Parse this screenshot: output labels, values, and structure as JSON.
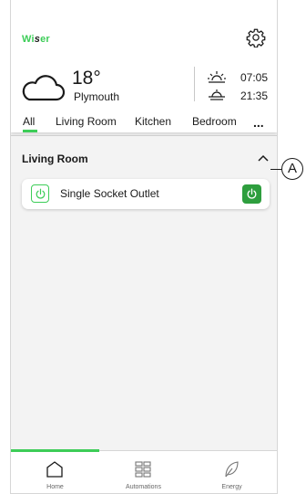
{
  "app": {
    "logo_prefix": "Wi",
    "logo_mid": "s",
    "logo_suffix": "er"
  },
  "weather": {
    "icon": "cloud-icon",
    "temperature": "18°",
    "city": "Plymouth",
    "sunrise": "07:05",
    "sunset": "21:35"
  },
  "tabs": [
    {
      "label": "All",
      "selected": true
    },
    {
      "label": "Living Room"
    },
    {
      "label": "Kitchen"
    },
    {
      "label": "Bedroom"
    }
  ],
  "more_label": "...",
  "room": {
    "title": "Living Room",
    "devices": [
      {
        "label": "Single Socket Outlet",
        "icon": "power-icon",
        "state": "on"
      }
    ]
  },
  "bottom_nav": [
    {
      "label": "Home",
      "icon": "home-icon",
      "active": true
    },
    {
      "label": "Automations",
      "icon": "grid-icon"
    },
    {
      "label": "Energy",
      "icon": "leaf-icon"
    }
  ],
  "callout": "A",
  "colors": {
    "accent": "#3dcd58",
    "toggle_on": "#2e9e3e"
  }
}
